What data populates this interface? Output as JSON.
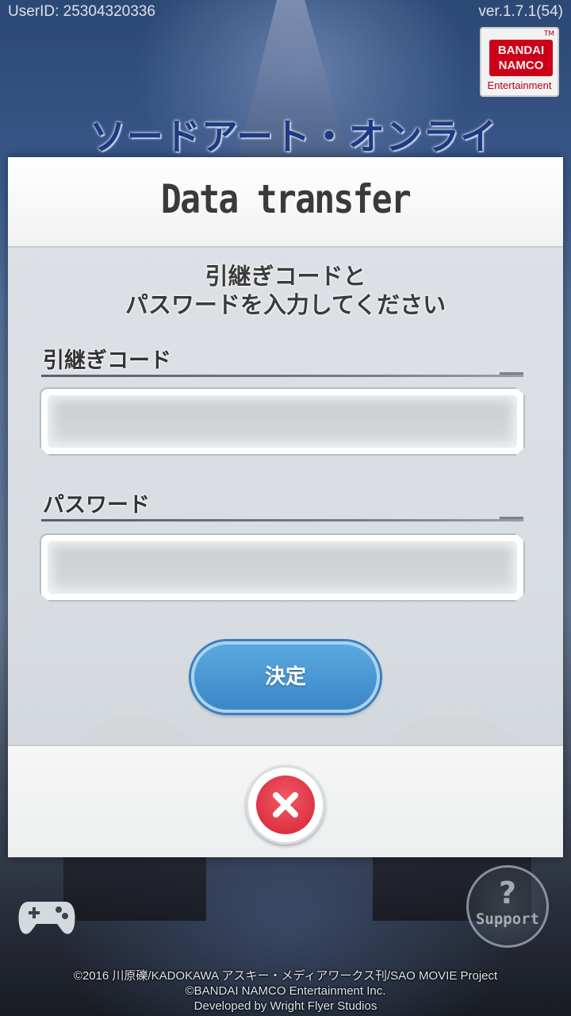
{
  "status": {
    "user_id": "UserID: 25304320336",
    "version": "ver.1.7.1(54)"
  },
  "publisher_logo": {
    "line1": "BANDAI",
    "line2": "NAMCO",
    "line3": "Entertainment",
    "tm": "TM"
  },
  "game_title": "ソードアート・オンライン",
  "dialog": {
    "title": "Data transfer",
    "instruction_line1": "引継ぎコードと",
    "instruction_line2": "パスワードを入力してください",
    "code_label": "引継ぎコード",
    "code_value": "",
    "password_label": "パスワード",
    "password_value": "",
    "confirm_button": "決定",
    "close_icon": "close-x-icon"
  },
  "support_button": {
    "symbol": "?",
    "label": "Support"
  },
  "credits": {
    "line1": "©2016 川原礫/KADOKAWA アスキー・メディアワークス刊/SAO MOVIE Project",
    "line2": "©BANDAI NAMCO Entertainment Inc.",
    "line3": "Developed by Wright Flyer Studios"
  },
  "colors": {
    "confirm_button": "#4a97d4",
    "close_button": "#e33a4a",
    "title_text": "#3a3a3a"
  }
}
